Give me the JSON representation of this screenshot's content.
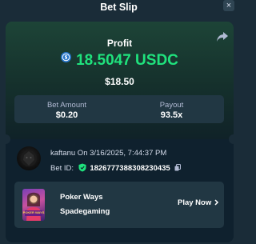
{
  "header": {
    "title": "Bet Slip",
    "close_icon": "close-icon"
  },
  "profit": {
    "label": "Profit",
    "currency_icon": "usdc-icon",
    "amount": "18.5047 USDC",
    "usd_value": "$18.50"
  },
  "stats": {
    "bet_amount_label": "Bet Amount",
    "bet_amount_value": "$0.20",
    "payout_label": "Payout",
    "payout_value": "93.5x"
  },
  "bet_info": {
    "user_line": "kaftanu On 3/16/2025, 7:44:37 PM",
    "bet_id_label": "Bet ID:",
    "bet_id_value": "182677738830823043​5"
  },
  "game": {
    "name": "Poker Ways",
    "provider": "Spadegaming",
    "play_label": "Play Now",
    "thumb_text": "POKER WAYS"
  },
  "colors": {
    "background": "#1a2c38",
    "card": "#0f212e",
    "panel": "#213743",
    "profit_green": "#1fe27d"
  }
}
